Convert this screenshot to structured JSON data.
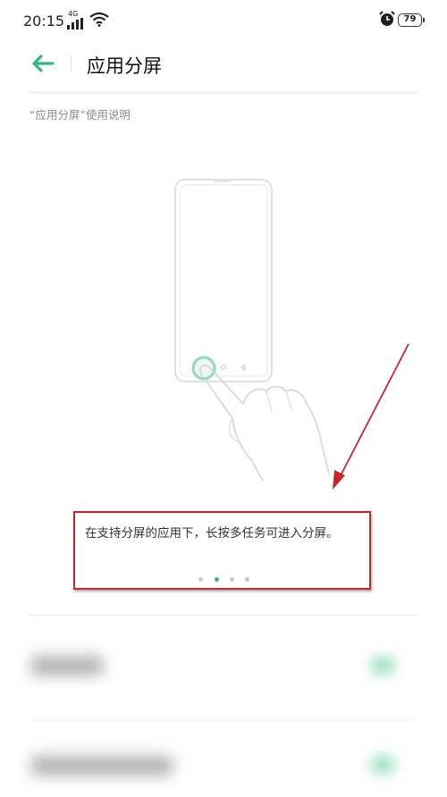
{
  "status_bar": {
    "time": "20:15",
    "network": "4G",
    "battery": "79"
  },
  "header": {
    "title": "应用分屏"
  },
  "instructions": {
    "heading": "“应用分屏”使用说明"
  },
  "tip": {
    "text": "在支持分屏的应用下，长按多任务可进入分屏。",
    "page_count": 4,
    "active_page_index": 1
  },
  "colors": {
    "accent": "#2bbb7b",
    "annotation": "#c8262b"
  },
  "icons": {
    "back": "arrow-left-icon",
    "signal": "signal-icon",
    "wifi": "wifi-icon",
    "alarm": "alarm-icon",
    "battery": "battery-icon"
  }
}
